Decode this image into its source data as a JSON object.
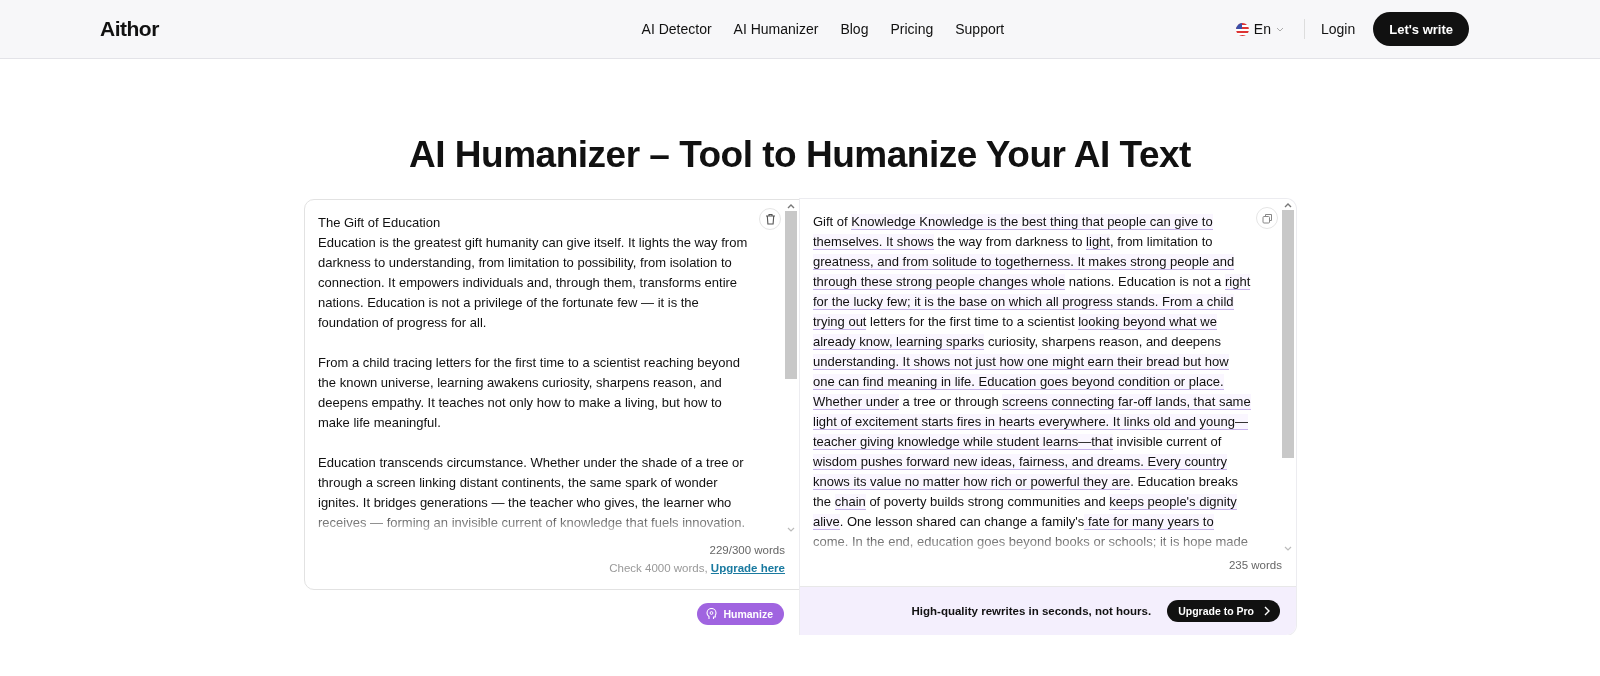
{
  "header": {
    "logo": "Aithor",
    "nav": [
      {
        "label": "AI Detector"
      },
      {
        "label": "AI Humanizer"
      },
      {
        "label": "Blog"
      },
      {
        "label": "Pricing"
      },
      {
        "label": "Support"
      }
    ],
    "language": "En",
    "login": "Login",
    "cta": "Let's write"
  },
  "title": "AI Humanizer – Tool to Humanize Your AI Text",
  "input": {
    "heading": "The Gift of Education",
    "paragraphs": [
      "Education is the greatest gift humanity can give itself. It lights the way from darkness to understanding, from limitation to possibility, from isolation to connection. It empowers individuals and, through them, transforms entire nations. Education is not a privilege of the fortunate few — it is the foundation of progress for all.",
      "From a child tracing letters for the first time to a scientist reaching beyond the known universe, learning awakens curiosity, sharpens reason, and deepens empathy. It teaches not only how to make a living, but how to make life meaningful.",
      "Education transcends circumstance. Whether under the shade of a tree or through a screen linking distant continents, the same spark of wonder ignites. It bridges generations — the teacher who gives, the learner who receives — forming an invisible current of knowledge that fuels innovation."
    ],
    "count": "229/300 words",
    "limit_note": "Check 4000 words,",
    "upgrade_link": "Upgrade here",
    "button": "Humanize"
  },
  "output": {
    "segments": [
      {
        "text": "Gift of ",
        "highlighted": false
      },
      {
        "text": "Knowledge Knowledge is the best thing that people can give to themselves. It shows",
        "highlighted": true
      },
      {
        "text": " the way from darkness to ",
        "highlighted": false
      },
      {
        "text": "light",
        "highlighted": true
      },
      {
        "text": ", from limitation to ",
        "highlighted": false
      },
      {
        "text": "greatness, and from solitude to togetherness. It makes strong people and through these strong people changes whole",
        "highlighted": true
      },
      {
        "text": " nations. Education is not a ",
        "highlighted": false
      },
      {
        "text": "right for the lucky few; it is the base on which all progress stands. From a child trying out",
        "highlighted": true
      },
      {
        "text": " letters for the first time to a scientist ",
        "highlighted": false
      },
      {
        "text": "looking beyond what we already know, learning sparks",
        "highlighted": true
      },
      {
        "text": " curiosity, sharpens reason, and deepens ",
        "highlighted": false
      },
      {
        "text": "understanding. It shows not just how one might earn their bread but how one can find meaning in life. Education goes beyond condition or place. Whether under",
        "highlighted": true
      },
      {
        "text": " a tree or through ",
        "highlighted": false
      },
      {
        "text": "screens connecting far-off lands, that same light of excitement starts fires in hearts everywhere. It links old and young—teacher giving knowledge while student learns—that",
        "highlighted": true
      },
      {
        "text": " invisible current of ",
        "highlighted": false
      },
      {
        "text": "wisdom pushes forward new ideas, fairness, and dreams. Every country knows its value no matter how rich or powerful they are",
        "highlighted": true
      },
      {
        "text": ". Education breaks the ",
        "highlighted": false
      },
      {
        "text": "chain",
        "highlighted": true
      },
      {
        "text": " of poverty builds strong communities and ",
        "highlighted": false
      },
      {
        "text": "keeps people's dignity alive",
        "highlighted": true
      },
      {
        "text": ". One lesson shared can change a family's",
        "highlighted": false
      },
      {
        "text": " fate for many years to",
        "highlighted": true
      },
      {
        "text": " come. In the end, education goes beyond books or schools; it is hope made",
        "highlighted": false
      }
    ],
    "count": "235 words",
    "promo": "High-quality rewrites in seconds, not hours.",
    "button": "Upgrade to Pro"
  }
}
